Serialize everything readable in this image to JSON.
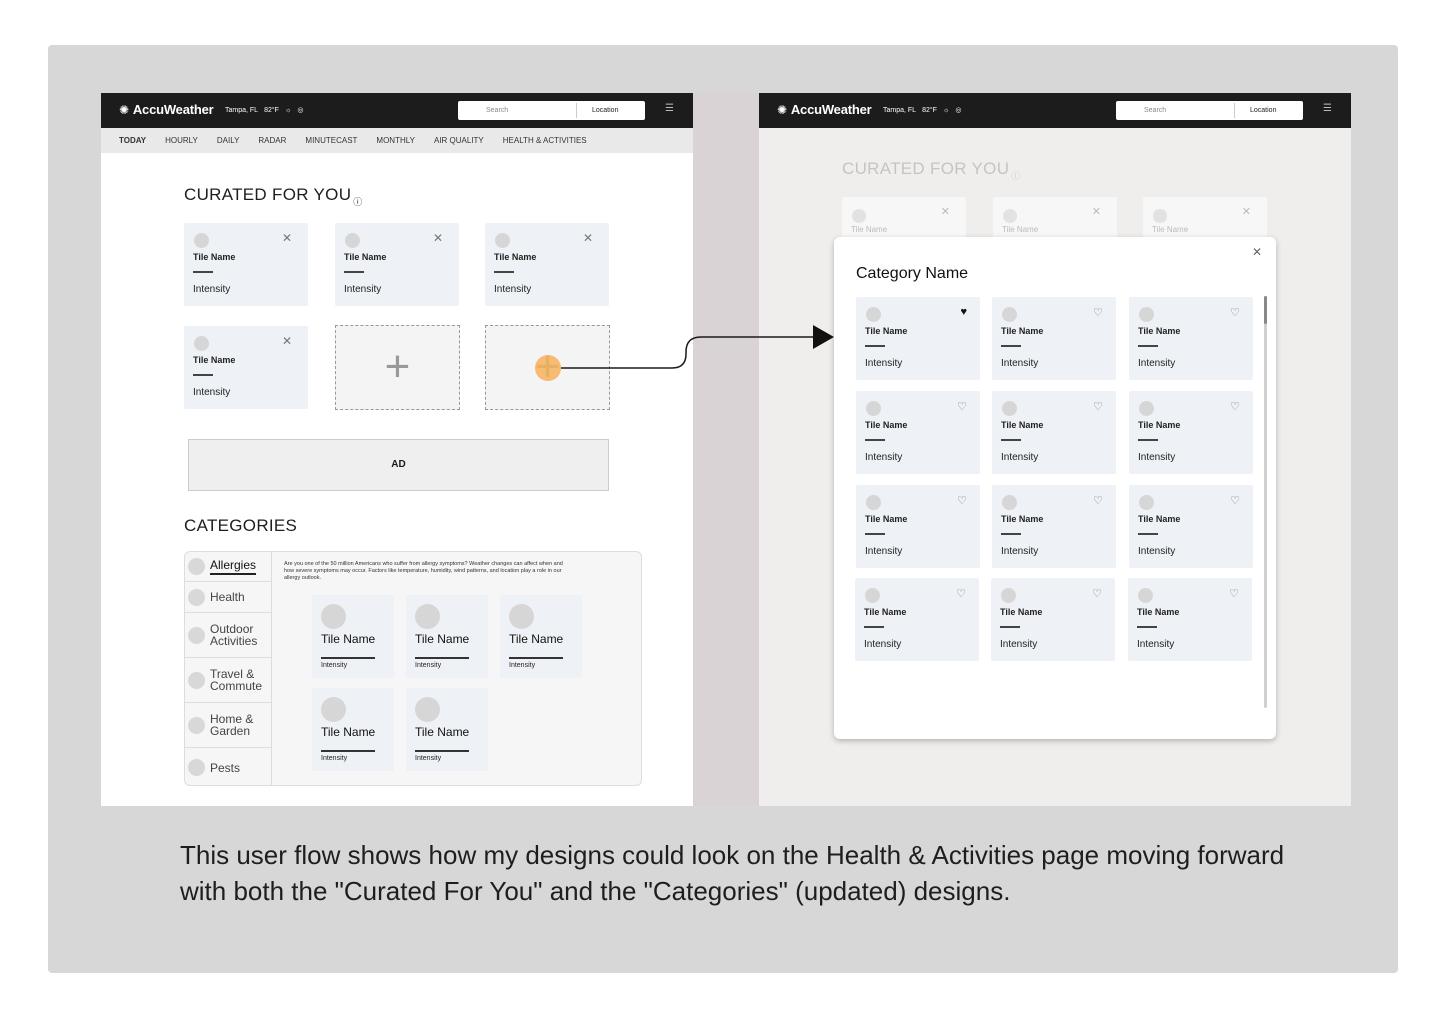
{
  "header": {
    "logo": "AccuWeather",
    "location": "Tampa, FL",
    "temp": "82°F",
    "search_placeholder": "Search",
    "location_label": "Location"
  },
  "nav": [
    "TODAY",
    "HOURLY",
    "DAILY",
    "RADAR",
    "MINUTECAST",
    "MONTHLY",
    "AIR QUALITY",
    "HEALTH & ACTIVITIES"
  ],
  "curated": {
    "title": "CURATED FOR YOU",
    "tile_name": "Tile Name",
    "tile_intensity": "Intensity"
  },
  "ad_label": "AD",
  "categories": {
    "title": "CATEGORIES",
    "items": [
      "Allergies",
      "Health",
      "Outdoor Activities",
      "Travel & Commute",
      "Home & Garden",
      "Pests"
    ],
    "active": "Allergies",
    "description": "Are you one of the 50 million Americans who suffer from allergy symptoms? Weather changes can affect when and how severe symptoms may occur. Factors like temperature, humidity, wind patterns, and location play a role in our allergy outlook.",
    "tile_name": "Tile Name",
    "tile_intensity": "Intensity"
  },
  "modal": {
    "title": "Category Name",
    "tile_name": "Tile Name",
    "tile_intensity": "Intensity"
  },
  "caption": "This user flow shows how my designs could look on the Health & Activities page moving forward with both the \"Curated For You\" and the \"Categories\" (updated) designs."
}
